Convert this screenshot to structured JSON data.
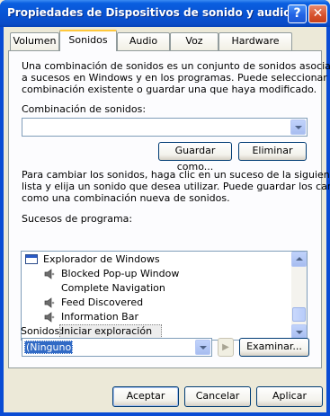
{
  "window": {
    "title": "Propiedades de Dispositivos de sonido y audio",
    "help_glyph": "?",
    "close_glyph": "✕"
  },
  "tabs": [
    {
      "label": "Volumen"
    },
    {
      "label": "Sonidos"
    },
    {
      "label": "Audio"
    },
    {
      "label": "Voz"
    },
    {
      "label": "Hardware"
    }
  ],
  "sounds": {
    "intro_lines": [
      "Una combinación de sonidos es un conjunto de sonidos asociados",
      "a sucesos en Windows y en los programas. Puede seleccionar una",
      "combinación existente o guardar una que haya modificado."
    ],
    "scheme_label": "Combinación de sonidos:",
    "scheme_value": "",
    "save_as_label": "Guardar como...",
    "delete_label": "Eliminar",
    "change_lines": [
      "Para cambiar los sonidos, haga clic en un suceso de la siguiente",
      "lista y elija un sonido que desea utilizar. Puede guardar los cambios",
      "como una combinación nueva de sonidos."
    ],
    "events_label": "Sucesos de programa:",
    "events": [
      {
        "label": "Explorador de Windows",
        "icon": "window-icon",
        "indent": 0,
        "has_sound": false
      },
      {
        "label": "Blocked Pop-up Window",
        "icon": "speaker-icon",
        "indent": 1,
        "has_sound": true
      },
      {
        "label": "Complete Navigation",
        "icon": "",
        "indent": 1,
        "has_sound": false
      },
      {
        "label": "Feed Discovered",
        "icon": "speaker-icon",
        "indent": 1,
        "has_sound": true
      },
      {
        "label": "Information Bar",
        "icon": "speaker-icon",
        "indent": 1,
        "has_sound": true
      },
      {
        "label": "Iniciar exploración",
        "icon": "",
        "indent": 1,
        "has_sound": false,
        "selected": true
      }
    ],
    "sounds_label": "Sonidos:",
    "sound_value": "(Ninguno)",
    "play_glyph": "▶",
    "browse_label": "Examinar..."
  },
  "footer": {
    "accept_label": "Aceptar",
    "cancel_label": "Cancelar",
    "apply_label": "Aplicar"
  },
  "colors": {
    "title_bar": "#0A4CD4",
    "dialog_bg": "#ECE9D8",
    "tab_highlight": "#FFC83C",
    "selection_bg": "#316AC5"
  }
}
